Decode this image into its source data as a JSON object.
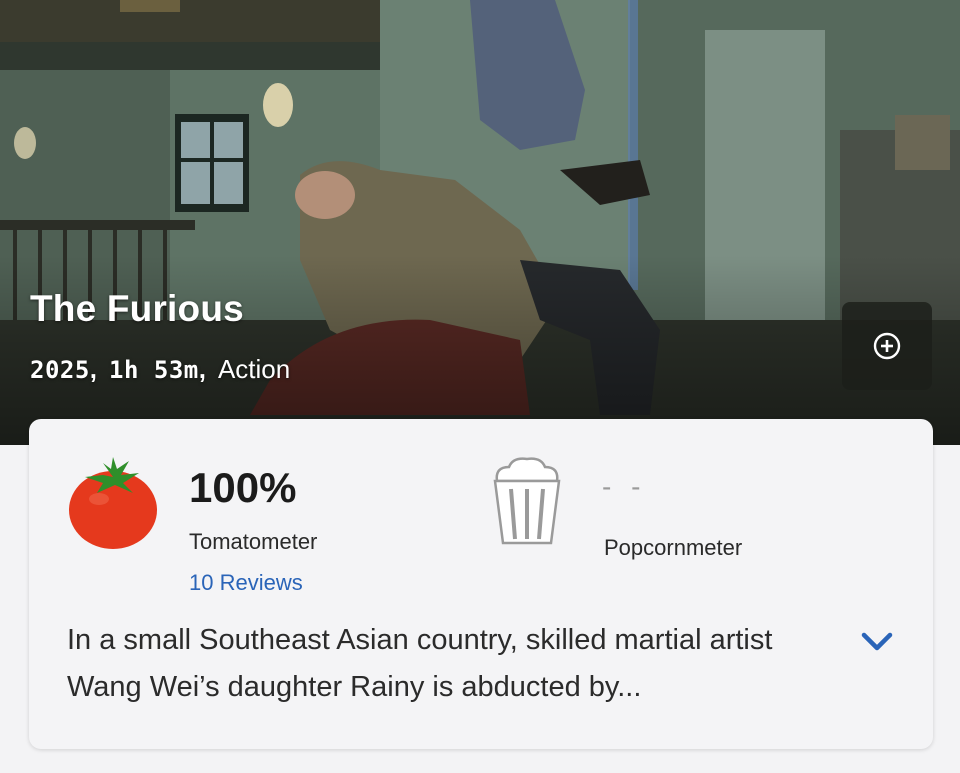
{
  "movie": {
    "title": "The Furious",
    "year": "2025",
    "runtime": "1h 53m",
    "genre": "Action"
  },
  "actions": {
    "add_icon": "plus-circle-icon"
  },
  "scores": {
    "tomatometer": {
      "value": "100%",
      "label": "Tomatometer",
      "reviews_link": "10 Reviews",
      "icon": "tomato-icon"
    },
    "popcornmeter": {
      "value": "- -",
      "label": "Popcornmeter",
      "icon": "popcorn-bucket-icon"
    }
  },
  "synopsis": {
    "text": "In a small Southeast Asian country, skilled martial artist Wang Wei’s daughter Rainy is abducted by...",
    "expand_icon": "chevron-down-icon"
  },
  "colors": {
    "link": "#2a64b8",
    "chevron": "#2a64b8",
    "tomato": "#e5391d",
    "tomato_leaf": "#2f8f2a"
  }
}
